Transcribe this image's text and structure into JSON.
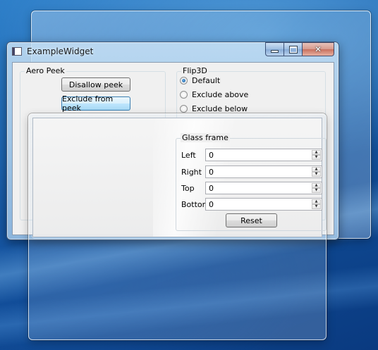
{
  "main_window": {
    "title": "ExampleWidget",
    "caption": {
      "minimize": "minimize",
      "maximize": "maximize",
      "close": "✕"
    }
  },
  "aero_peek": {
    "title": "Aero Peek",
    "disallow_label": "Disallow peek",
    "exclude_label": "Exclude from peek"
  },
  "flip3d": {
    "title": "Flip3D",
    "options": [
      "Default",
      "Exclude above",
      "Exclude below"
    ],
    "selected": "Default"
  },
  "glass_frame": {
    "title": "Glass frame",
    "fields": [
      {
        "label": "Left",
        "value": "0"
      },
      {
        "label": "Right",
        "value": "0"
      },
      {
        "label": "Top",
        "value": "0"
      },
      {
        "label": "Bottom",
        "value": "0"
      }
    ],
    "reset_label": "Reset"
  },
  "icons": {
    "spin_up": "▲",
    "spin_down": "▼"
  }
}
